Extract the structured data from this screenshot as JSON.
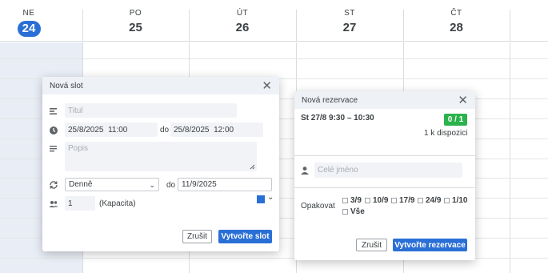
{
  "calendar": {
    "days": [
      {
        "name": "NE",
        "num": "24",
        "today": true
      },
      {
        "name": "PO",
        "num": "25"
      },
      {
        "name": "ÚT",
        "num": "26"
      },
      {
        "name": "ST",
        "num": "27"
      },
      {
        "name": "ČT",
        "num": "28"
      }
    ],
    "accent": "#2a6fd6"
  },
  "slot_dialog": {
    "title": "Nová slot",
    "title_placeholder": "Titul",
    "start_date": "25/8/2025",
    "start_time": "11:00",
    "to_label": "do",
    "end_date": "25/8/2025",
    "end_time": "12:00",
    "description_placeholder": "Popis",
    "repeat_value": "Denně",
    "repeat_to_label": "do",
    "repeat_until": "11/9/2025",
    "capacity_value": "1",
    "capacity_label": "(Kapacita)",
    "color": "#2a6fd6",
    "cancel_label": "Zrušit",
    "submit_label": "Vytvořte slot"
  },
  "reservation_dialog": {
    "title": "Nová rezervace",
    "slot_time": "St 27/8  9:30 – 10:30",
    "badge": "0 / 1",
    "badge_color": "#2bb24c",
    "available": "1 k dispozici",
    "name_placeholder": "Celé jméno",
    "repeat_label": "Opakovat",
    "repeat_options": [
      "3/9",
      "10/9",
      "17/9",
      "24/9",
      "1/10",
      "Vše"
    ],
    "cancel_label": "Zrušit",
    "submit_label": "Vytvořte rezervace"
  }
}
